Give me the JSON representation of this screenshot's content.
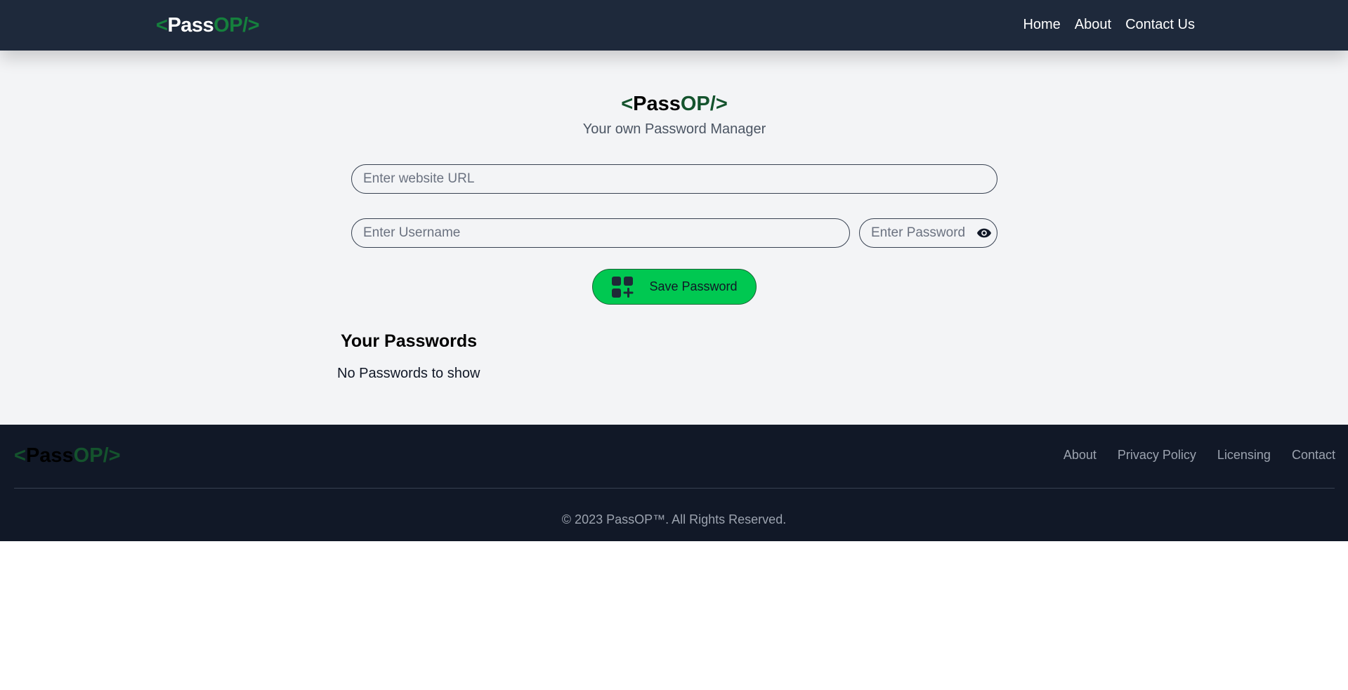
{
  "brand": {
    "open": "<",
    "pass": "Pass",
    "op": "OP/",
    "close": ">"
  },
  "nav": {
    "links": [
      "Home",
      "About",
      "Contact Us"
    ]
  },
  "hero": {
    "subtitle": "Your own Password Manager"
  },
  "form": {
    "url_placeholder": "Enter website URL",
    "username_placeholder": "Enter Username",
    "password_placeholder": "Enter Password",
    "save_label": "Save Password"
  },
  "passwords": {
    "heading": "Your Passwords",
    "empty_text": "No Passwords to show"
  },
  "footer": {
    "links": [
      "About",
      "Privacy Policy",
      "Licensing",
      "Contact"
    ],
    "copyright": "© 2023 PassOP™. All Rights Reserved."
  },
  "colors": {
    "navbar": "#1e293b",
    "footer": "#111827",
    "accent_green": "#00c851",
    "logo_green": "#15803d"
  },
  "icons": {
    "password_toggle": "eye-icon",
    "save": "add-grid-icon"
  }
}
